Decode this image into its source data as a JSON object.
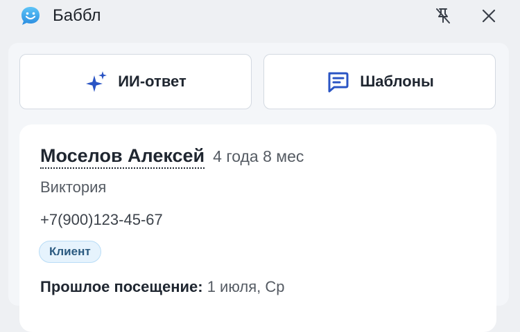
{
  "app": {
    "title": "Баббл",
    "logo_icon": "speech-bubble-smile-icon",
    "pin_icon": "pin-off-icon",
    "close_icon": "close-icon"
  },
  "actions": {
    "ai_reply_label": "ИИ-ответ",
    "ai_reply_icon": "sparkles-icon",
    "templates_label": "Шаблоны",
    "templates_icon": "message-lines-icon"
  },
  "client": {
    "name": "Моселов Алексей",
    "age": "4 года 8 мес",
    "master": "Виктория",
    "phone": "+7(900)123-45-67",
    "status_badge": "Клиент",
    "last_visit_label": "Прошлое посещение:",
    "last_visit_value": "1 июля, Ср"
  },
  "colors": {
    "accent_blue": "#2a54c4",
    "badge_bg": "#e6f3fd",
    "badge_text": "#2b5a80"
  }
}
